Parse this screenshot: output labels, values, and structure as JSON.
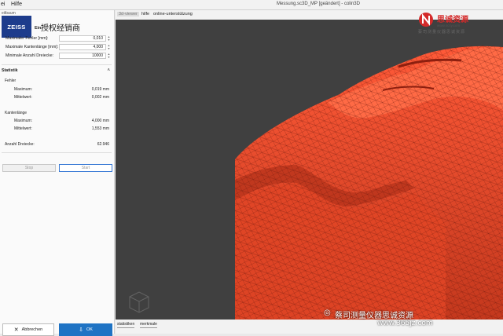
{
  "menubar": {
    "items": [
      "ei",
      "Hilfe"
    ],
    "window_title": "Messung.sc3D_MP [geändert] - colin3D"
  },
  "left_panel": {
    "title": "eitbaum",
    "brand_logo": "ZEISS",
    "brand_badge": "授权经销商",
    "settings": {
      "header": "Ein",
      "rows": [
        {
          "label": "Maximaler Fehler [mm]:",
          "value": "0,010"
        },
        {
          "label": "Maximale Kantenlänge [mm]:",
          "value": "4,000"
        },
        {
          "label": "Minimale Anzahl Dreiecke:",
          "value": "10000"
        }
      ]
    },
    "statistik": {
      "header": "Statistik",
      "fehler_label": "Fehler",
      "fehler_max_label": "Maximum:",
      "fehler_max_value": "0,019 mm",
      "fehler_mean_label": "Mittelwert:",
      "fehler_mean_value": "0,002 mm",
      "kanten_label": "Kantenlänge",
      "kanten_max_label": "Maximum:",
      "kanten_max_value": "4,000 mm",
      "kanten_mean_label": "Mittelwert:",
      "kanten_mean_value": "1,553 mm",
      "dreiecke_label": "Anzahl Dreiecke:",
      "dreiecke_value": "62.946"
    },
    "stop_label": "Stop",
    "start_label": "Start",
    "cancel_label": "Abbrechen",
    "ok_label": "OK"
  },
  "viewer": {
    "tabs": [
      "3d-viewer",
      "hilfe",
      "online-unterstützung"
    ],
    "bottom_tabs": [
      "statistiken",
      "merkmale"
    ]
  },
  "overlay": {
    "logo_name": "思诚资源",
    "logo_url": "www.scsy.com",
    "logo_tagline": "蔡司测量仪器思诚资源",
    "watermark_text": "蔡司测量仪器思诚资源",
    "watermark_url": "www.365jz.com"
  },
  "colors": {
    "mesh": "#e8452a",
    "viewport_bg": "#404040",
    "ok_button": "#1f73c4",
    "brand_blue": "#1d3c8c"
  }
}
